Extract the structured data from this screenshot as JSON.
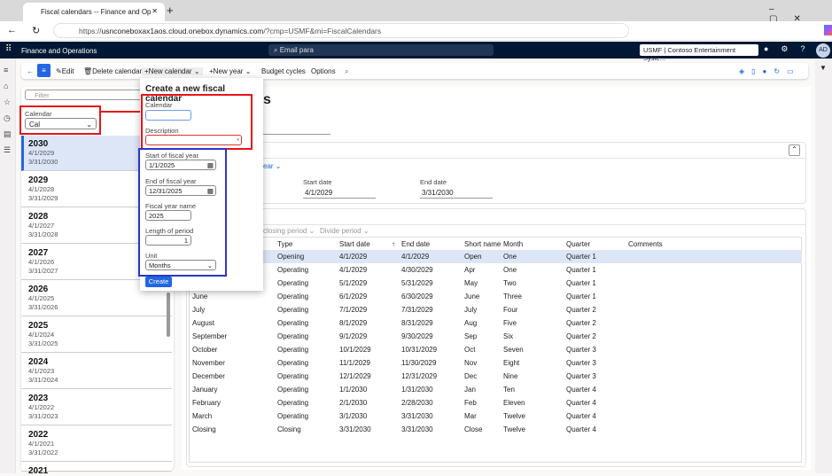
{
  "browser": {
    "tab_title": "Fiscal calendars -- Finance and Op",
    "url_prefix": "https://",
    "url_host": "usnconeboxax1aos.cloud.onebox.dynamics.com",
    "url_path": "/?cmp=USMF&mi=FiscalCalendars"
  },
  "nav": {
    "app_title": "Finance and Operations",
    "search": "Email para",
    "company": "USMF | Contoso Entertainment Syste...",
    "avatar": "AD"
  },
  "toolbar": {
    "edit": "Edit",
    "delete": "Delete calendar",
    "new_calendar": "New calendar",
    "new_year": "New year",
    "budget_cycles": "Budget cycles",
    "options": "Options"
  },
  "left": {
    "filter_placeholder": "Filter",
    "calendar_label": "Calendar",
    "calendar_value": "Cal",
    "years": [
      {
        "year": "2030",
        "start": "4/1/2029",
        "end": "3/31/2030"
      },
      {
        "year": "2029",
        "start": "4/1/2028",
        "end": "3/31/2029"
      },
      {
        "year": "2028",
        "start": "4/1/2027",
        "end": "3/31/2028"
      },
      {
        "year": "2027",
        "start": "4/1/2026",
        "end": "3/31/2027"
      },
      {
        "year": "2026",
        "start": "4/1/2025",
        "end": "3/31/2026"
      },
      {
        "year": "2025",
        "start": "4/1/2024",
        "end": "3/31/2025"
      },
      {
        "year": "2024",
        "start": "4/1/2023",
        "end": "3/31/2024"
      },
      {
        "year": "2023",
        "start": "4/1/2022",
        "end": "3/31/2023"
      },
      {
        "year": "2022",
        "start": "4/1/2021",
        "end": "3/31/2022"
      },
      {
        "year": "2021",
        "start": "",
        "end": ""
      }
    ]
  },
  "main": {
    "title_tail": "s",
    "year_link_tail": "ear",
    "start_label": "Start date",
    "start_value": "4/1/2029",
    "end_label": "End date",
    "end_value": "3/31/2030",
    "closing_period": "closing period",
    "divide_period": "Divide period",
    "columns": [
      "Type",
      "Start date",
      "End date",
      "Short name",
      "Month",
      "Quarter",
      "Comments"
    ],
    "rows": [
      {
        "name": "",
        "type": "Opening",
        "start": "4/1/2029",
        "end": "4/1/2029",
        "short": "Open",
        "month": "One",
        "quarter": "Quarter 1"
      },
      {
        "name": "",
        "type": "Operating",
        "start": "4/1/2029",
        "end": "4/30/2029",
        "short": "Apr",
        "month": "One",
        "quarter": "Quarter 1"
      },
      {
        "name": "",
        "type": "Operating",
        "start": "5/1/2029",
        "end": "5/31/2029",
        "short": "May",
        "month": "Two",
        "quarter": "Quarter 1"
      },
      {
        "name": "June",
        "type": "Operating",
        "start": "6/1/2029",
        "end": "6/30/2029",
        "short": "June",
        "month": "Three",
        "quarter": "Quarter 1"
      },
      {
        "name": "July",
        "type": "Operating",
        "start": "7/1/2029",
        "end": "7/31/2029",
        "short": "July",
        "month": "Four",
        "quarter": "Quarter 2"
      },
      {
        "name": "August",
        "type": "Operating",
        "start": "8/1/2029",
        "end": "8/31/2029",
        "short": "Aug",
        "month": "Five",
        "quarter": "Quarter 2"
      },
      {
        "name": "September",
        "type": "Operating",
        "start": "9/1/2029",
        "end": "9/30/2029",
        "short": "Sep",
        "month": "Six",
        "quarter": "Quarter 2"
      },
      {
        "name": "October",
        "type": "Operating",
        "start": "10/1/2029",
        "end": "10/31/2029",
        "short": "Oct",
        "month": "Seven",
        "quarter": "Quarter 3"
      },
      {
        "name": "November",
        "type": "Operating",
        "start": "11/1/2029",
        "end": "11/30/2029",
        "short": "Nov",
        "month": "Eight",
        "quarter": "Quarter 3"
      },
      {
        "name": "December",
        "type": "Operating",
        "start": "12/1/2029",
        "end": "12/31/2029",
        "short": "Dec",
        "month": "Nine",
        "quarter": "Quarter 3"
      },
      {
        "name": "January",
        "type": "Operating",
        "start": "1/1/2030",
        "end": "1/31/2030",
        "short": "Jan",
        "month": "Ten",
        "quarter": "Quarter 4"
      },
      {
        "name": "February",
        "type": "Operating",
        "start": "2/1/2030",
        "end": "2/28/2030",
        "short": "Feb",
        "month": "Eleven",
        "quarter": "Quarter 4"
      },
      {
        "name": "March",
        "type": "Operating",
        "start": "3/1/2030",
        "end": "3/31/2030",
        "short": "Mar",
        "month": "Twelve",
        "quarter": "Quarter 4"
      },
      {
        "name": "Closing",
        "type": "Closing",
        "start": "3/31/2030",
        "end": "3/31/2030",
        "short": "Close",
        "month": "Twelve",
        "quarter": "Quarter 4"
      }
    ]
  },
  "popup": {
    "title": "Create a new fiscal calendar",
    "calendar_label": "Calendar",
    "calendar_value": "",
    "description_label": "Description",
    "description_value": "",
    "start_label": "Start of fiscal year",
    "start_value": "1/1/2025",
    "end_label": "End of fiscal year",
    "end_value": "12/31/2025",
    "name_label": "Fiscal year name",
    "name_value": "2025",
    "length_label": "Length of period",
    "length_value": "1",
    "unit_label": "Unit",
    "unit_value": "Months",
    "create": "Create"
  },
  "colors": {
    "accent": "#2266e3",
    "nav": "#001833",
    "highlight_red": "#e8141a",
    "highlight_blue": "#2b35c9"
  }
}
